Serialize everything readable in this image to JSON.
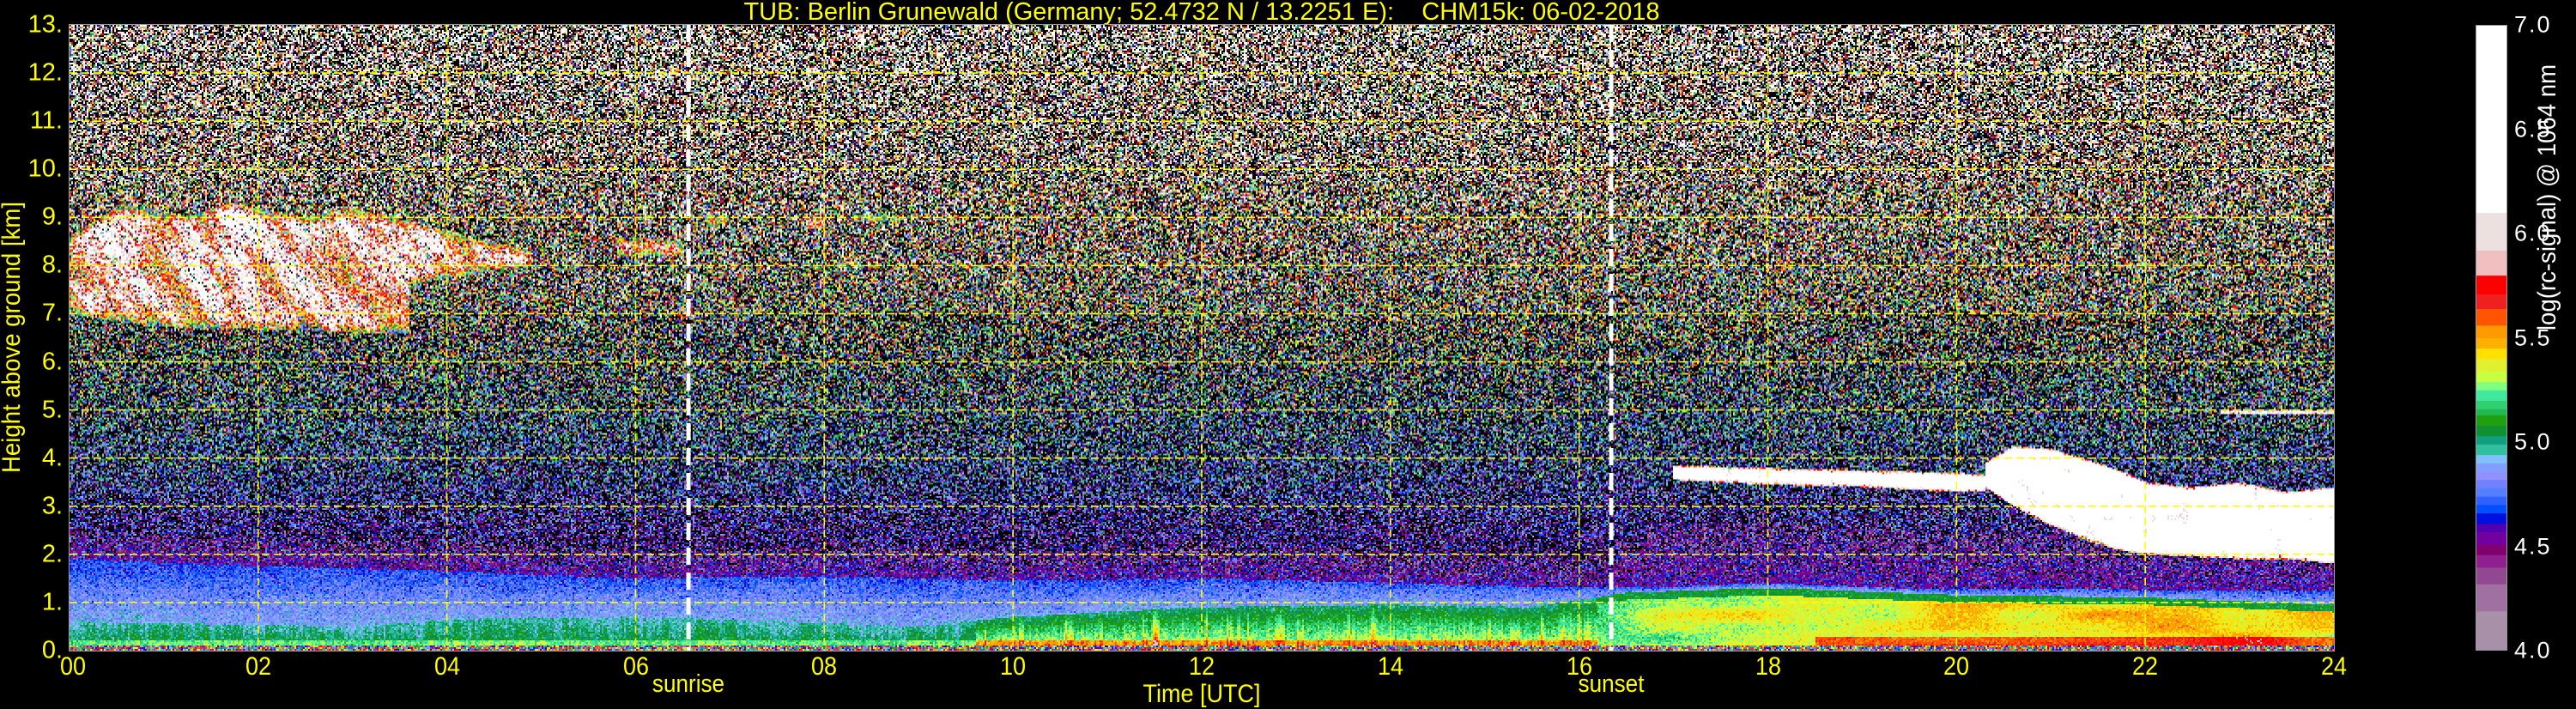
{
  "title": "TUB: Berlin Grunewald (Germany; 52.4732 N / 13.2251 E):    CHM15k: 06-02-2018",
  "chart_data": {
    "type": "heatmap",
    "xlabel": "Time [UTC]",
    "ylabel": "Height above ground [km]",
    "xlim": [
      0,
      24
    ],
    "ylim": [
      0,
      13
    ],
    "x_tick_values": [
      0,
      2,
      4,
      6,
      8,
      10,
      12,
      14,
      16,
      18,
      20,
      22,
      24
    ],
    "x_ticks": [
      "00",
      "02",
      "04",
      "06",
      "08",
      "10",
      "12",
      "14",
      "16",
      "18",
      "20",
      "22",
      "24"
    ],
    "y_tick_values": [
      0,
      1,
      2,
      3,
      4,
      5,
      6,
      7,
      8,
      9,
      10,
      11,
      12,
      13
    ],
    "y_ticks": [
      "0.",
      "1.",
      "2.",
      "3.",
      "4.",
      "5.",
      "6.",
      "7.",
      "8.",
      "9.",
      "10.",
      "11.",
      "12.",
      "13."
    ],
    "grid": true,
    "annotations": [
      {
        "label": "sunrise",
        "time": 6.56
      },
      {
        "label": "sunset",
        "time": 16.34
      }
    ],
    "colorbar": {
      "label": "log(rc-signal) @ 1064 nm",
      "range": [
        4.0,
        7.0
      ],
      "tick_values": [
        4.0,
        4.5,
        5.0,
        5.5,
        6.0,
        6.5,
        7.0
      ],
      "ticks": [
        "4.0",
        "4.5",
        "5.0",
        "5.5",
        "6.0",
        "6.5",
        "7.0"
      ],
      "boundaries": [
        4.0,
        4.19,
        4.32,
        4.4,
        4.46,
        4.51,
        4.57,
        4.61,
        4.66,
        4.7,
        4.74,
        4.78,
        4.82,
        4.86,
        4.9,
        4.94,
        4.99,
        5.03,
        5.08,
        5.13,
        5.16,
        5.2,
        5.25,
        5.29,
        5.34,
        5.4,
        5.45,
        5.5,
        5.56,
        5.64,
        5.71,
        5.8,
        5.92,
        6.1,
        7.0
      ],
      "colors": [
        "#a890a8",
        "#a070a0",
        "#904890",
        "#902090",
        "#800070",
        "#7000a0",
        "#5000b0",
        "#0010e0",
        "#0050ff",
        "#3060ff",
        "#5080ff",
        "#7080ff",
        "#9090ff",
        "#80a0ff",
        "#80c0ff",
        "#30c0a0",
        "#10a080",
        "#109030",
        "#20a010",
        "#20b850",
        "#30d070",
        "#40e8a0",
        "#80ff80",
        "#c8ff40",
        "#e0f030",
        "#ffe000",
        "#ffb000",
        "#ff9900",
        "#ff5500",
        "#f02020",
        "#ff0000",
        "#f0c0c0",
        "#ece0e0",
        "#ffffff"
      ]
    },
    "cloud_layers_km": [
      {
        "t": [
          0,
          0.6,
          1.2,
          1.7,
          2.5,
          3.0,
          3.6
        ],
        "top": [
          8.6,
          9.3,
          9.0,
          9.3,
          9.0,
          9.2,
          8.9
        ],
        "base": [
          7.0,
          6.8,
          6.7,
          6.7,
          6.65,
          6.6,
          6.6
        ],
        "structure": "streaky"
      },
      {
        "t": [
          3.6,
          4.2,
          4.9
        ],
        "top": [
          8.9,
          8.6,
          8.3
        ],
        "base": [
          7.6,
          7.8,
          8.0
        ],
        "structure": "streaky"
      },
      {
        "t": [
          5.8,
          6.5
        ],
        "top": [
          8.6,
          8.5
        ],
        "base": [
          8.2,
          8.2
        ],
        "structure": "streaky"
      },
      {
        "t": [
          6.75,
          6.95
        ],
        "top": [
          9.05,
          9.05
        ],
        "base": [
          8.8,
          8.8
        ],
        "structure": "streaky"
      },
      {
        "t": [
          7.8,
          8.0
        ],
        "top": [
          9.0,
          9.0
        ],
        "base": [
          8.75,
          8.75
        ],
        "structure": "streaky"
      },
      {
        "t": [
          8.3,
          8.8
        ],
        "top": [
          9.05,
          9.05
        ],
        "base": [
          8.9,
          8.9
        ],
        "structure": "streaky"
      },
      {
        "t": [
          17.0,
          18,
          19,
          20,
          20.3
        ],
        "top": [
          3.85,
          3.8,
          3.75,
          3.7,
          3.65
        ],
        "base": [
          3.55,
          3.45,
          3.4,
          3.3,
          3.3
        ],
        "structure": "dense",
        "virga_km": 0.7
      },
      {
        "t": [
          20.3,
          20.6,
          21,
          21.5,
          21.8,
          22,
          22.5,
          23,
          23.5,
          24
        ],
        "top": [
          3.9,
          4.25,
          4.2,
          3.9,
          3.7,
          3.5,
          3.4,
          3.5,
          3.3,
          3.4
        ],
        "base": [
          3.4,
          3.0,
          2.6,
          2.2,
          2.05,
          2.0,
          1.95,
          1.9,
          1.9,
          1.8
        ],
        "structure": "dense",
        "virga_km": 0.25
      },
      {
        "t": [
          22.8,
          24
        ],
        "top": [
          5.0,
          5.0
        ],
        "base": [
          4.9,
          4.9
        ],
        "structure": "dense",
        "virga_km": 0.9
      }
    ],
    "mixing_layer_top_km": {
      "t": [
        0,
        3,
        4,
        6,
        9,
        10,
        12,
        14,
        15.5,
        16.5,
        18,
        20,
        22,
        24
      ],
      "h": [
        0.6,
        0.5,
        0.65,
        0.7,
        0.5,
        0.7,
        0.9,
        0.95,
        0.9,
        1.2,
        1.3,
        1.15,
        1.1,
        0.95
      ]
    },
    "aerosol_layer_top_km": {
      "t": [
        0,
        2,
        4,
        6,
        8,
        10,
        12,
        14,
        16,
        16.5,
        24
      ],
      "h": [
        1.9,
        1.75,
        1.65,
        1.5,
        1.55,
        1.45,
        1.5,
        1.4,
        1.3,
        1.3,
        1.25
      ]
    }
  },
  "colors": {
    "text": "#ffff00",
    "colorbar_text": "#ffffff",
    "background": "#000000",
    "grid": "#ffff00",
    "sun_lines": "#ffffff"
  }
}
